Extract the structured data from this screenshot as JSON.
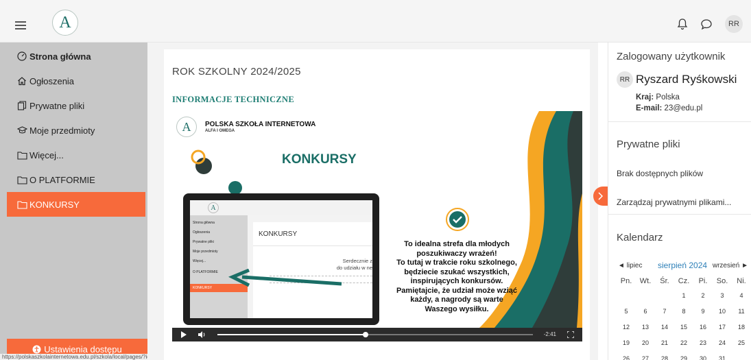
{
  "header": {
    "logo_letter": "A",
    "user_initials": "RR"
  },
  "sidebar": {
    "items": [
      {
        "label": "Strona główna"
      },
      {
        "label": "Ogłoszenia"
      },
      {
        "label": "Prywatne pliki"
      },
      {
        "label": "Moje przedmioty"
      },
      {
        "label": "Więcej..."
      },
      {
        "label": "O PLATFORMIE"
      },
      {
        "label": "KONKURSY"
      }
    ],
    "accessibility_label": "Ustawienia dostępu",
    "status_url": "https://polskaszkolainternetowa.edu.pl/szkola/local/pages/?id=3"
  },
  "main": {
    "course_title": "ROK SZKOLNY 2024/2025",
    "section_title": "INFORMACJE TECHNICZNE",
    "video": {
      "school_name": "POLSKA SZKOŁA INTERNETOWA",
      "school_sub": "ALFA I OMEGA",
      "heading": "KONKURSY",
      "text_lines": [
        "To idealna strefa dla młodych",
        "poszukiwaczy wrażeń!",
        "To tutaj w trakcie roku szkolnego,",
        "będziecie szukać wszystkich,",
        "inspirujących konkursów.",
        "Pamiętajcie, że udział może wziąć",
        "każdy, a nagrody są warte",
        "Waszego wysiłku."
      ],
      "screen": {
        "logo_letter": "A",
        "sidebar_items": [
          "Strona główna",
          "Ogłoszenia",
          "Prywatne pliki",
          "Moje przedmioty",
          "Więcej...",
          "O PLATFORMIE",
          "KONKURSY"
        ],
        "card_title": "KONKURSY",
        "card_text_1": "Serdecznie z",
        "card_text_2": "do udziału w ne"
      },
      "time_left": "-2:41",
      "progress": 0.47
    }
  },
  "right": {
    "user_block": {
      "title": "Zalogowany użytkownik",
      "initials": "RR",
      "name": "Ryszard Ryśkowski",
      "country_label": "Kraj:",
      "country": "Polska",
      "email_label": "E-mail:",
      "email": "23@edu.pl"
    },
    "files_block": {
      "title": "Prywatne pliki",
      "empty": "Brak dostępnych plików",
      "manage": "Zarządzaj prywatnymi plikami..."
    },
    "calendar": {
      "title": "Kalendarz",
      "prev": "lipiec",
      "current": "sierpień 2024",
      "next": "wrzesień",
      "weekdays": [
        "Pn.",
        "Wt.",
        "Śr.",
        "Cz.",
        "Pi.",
        "So.",
        "Ni."
      ],
      "weeks": [
        [
          "",
          "",
          "",
          "1",
          "2",
          "3",
          "4"
        ],
        [
          "5",
          "6",
          "7",
          "8",
          "9",
          "10",
          "11"
        ],
        [
          "12",
          "13",
          "14",
          "15",
          "16",
          "17",
          "18"
        ],
        [
          "19",
          "20",
          "21",
          "22",
          "23",
          "24",
          "25"
        ],
        [
          "26",
          "27",
          "28",
          "29",
          "30",
          "31",
          ""
        ]
      ]
    }
  },
  "colors": {
    "accent": "#f76a3b",
    "teal": "#1a6e66",
    "sidebar_bg": "#c7c7c7",
    "calendar_link": "#2e80b8"
  }
}
